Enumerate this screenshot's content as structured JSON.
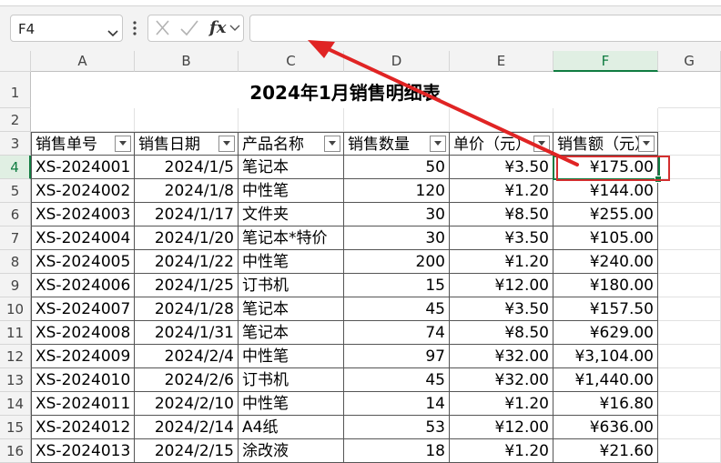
{
  "formula_bar": {
    "name_box": "F4",
    "formula": "",
    "cancel_icon": "close-icon",
    "enter_icon": "check-icon",
    "fx_label": "fx"
  },
  "columns": [
    "A",
    "B",
    "C",
    "D",
    "E",
    "F",
    "G"
  ],
  "active_column": "F",
  "active_row": 4,
  "rows": [
    1,
    2,
    3,
    4,
    5,
    6,
    7,
    8,
    9,
    10,
    11,
    12,
    13,
    14,
    15,
    16
  ],
  "sheet": {
    "title": "2024年1月销售明细表",
    "headers": [
      "销售单号",
      "销售日期",
      "产品名称",
      "销售数量",
      "单价（元）",
      "销售额（元）"
    ],
    "data": [
      [
        "XS-2024001",
        "2024/1/5",
        "笔记本",
        "50",
        "¥3.50",
        "¥175.00"
      ],
      [
        "XS-2024002",
        "2024/1/8",
        "中性笔",
        "120",
        "¥1.20",
        "¥144.00"
      ],
      [
        "XS-2024003",
        "2024/1/17",
        "文件夹",
        "30",
        "¥8.50",
        "¥255.00"
      ],
      [
        "XS-2024004",
        "2024/1/20",
        "笔记本*特价",
        "30",
        "¥3.50",
        "¥105.00"
      ],
      [
        "XS-2024005",
        "2024/1/22",
        "中性笔",
        "200",
        "¥1.20",
        "¥240.00"
      ],
      [
        "XS-2024006",
        "2024/1/25",
        "订书机",
        "15",
        "¥12.00",
        "¥180.00"
      ],
      [
        "XS-2024007",
        "2024/1/28",
        "笔记本",
        "45",
        "¥3.50",
        "¥157.50"
      ],
      [
        "XS-2024008",
        "2024/1/31",
        "笔记本",
        "74",
        "¥8.50",
        "¥629.00"
      ],
      [
        "XS-2024009",
        "2024/2/4",
        "中性笔",
        "97",
        "¥32.00",
        "¥3,104.00"
      ],
      [
        "XS-2024010",
        "2024/2/6",
        "订书机",
        "45",
        "¥32.00",
        "¥1,440.00"
      ],
      [
        "XS-2024011",
        "2024/2/10",
        "中性笔",
        "14",
        "¥1.20",
        "¥16.80"
      ],
      [
        "XS-2024012",
        "2024/2/14",
        "A4纸",
        "53",
        "¥12.00",
        "¥636.00"
      ],
      [
        "XS-2024013",
        "2024/2/15",
        "涂改液",
        "18",
        "¥1.20",
        "¥21.60"
      ]
    ]
  },
  "annotation": {
    "arrow_color": "#e02424",
    "box_color": "#d32f2f"
  },
  "accent_color": "#107c41"
}
